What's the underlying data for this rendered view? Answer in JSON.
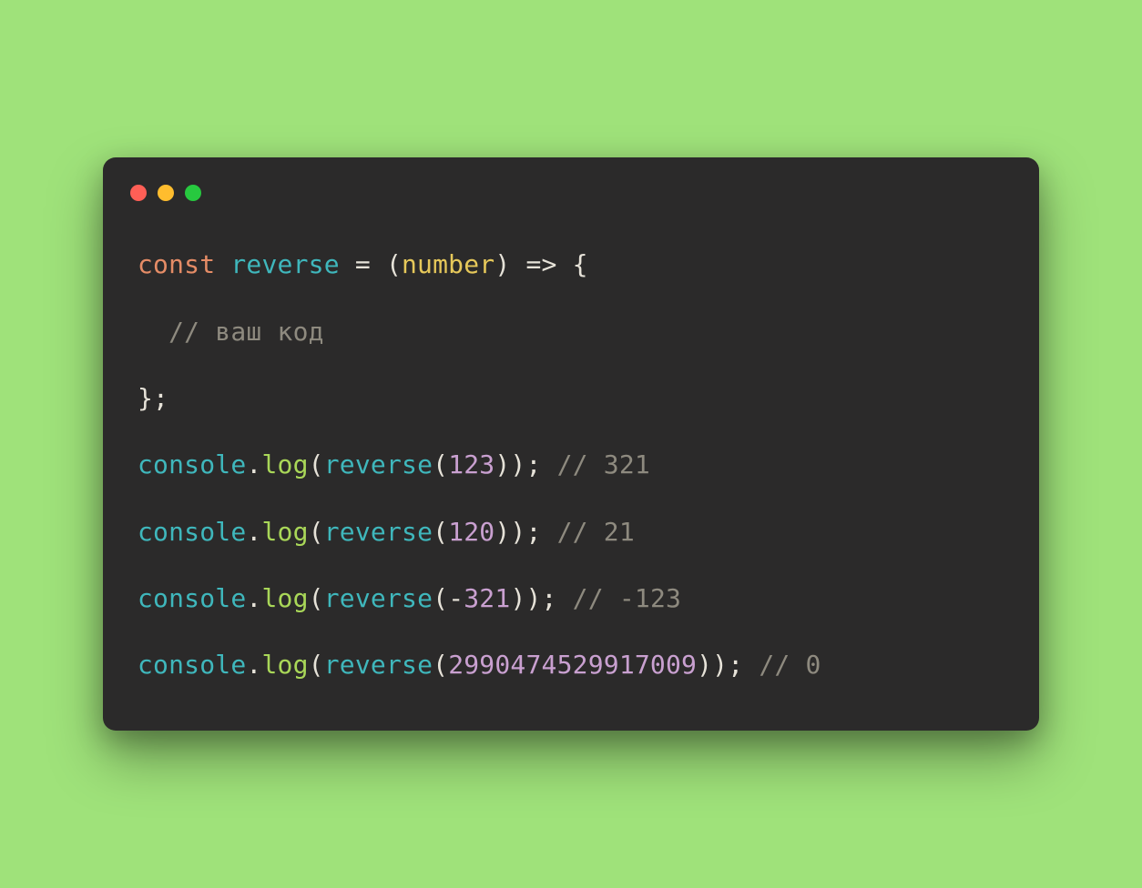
{
  "traffic_lights": {
    "red": "#ff5f56",
    "yellow": "#ffbd2e",
    "green": "#27c93f"
  },
  "code": {
    "line1": {
      "kw": "const",
      "name": "reverse",
      "eq": " = (",
      "param": "number",
      "arrow": ") => {"
    },
    "line2": {
      "indent": "  ",
      "comment": "// ваш код"
    },
    "line3": {
      "close": "};"
    },
    "blank": "",
    "line5": {
      "obj": "console",
      "dot": ".",
      "method": "log",
      "open": "(",
      "fn": "reverse",
      "open2": "(",
      "arg": "123",
      "close": ")); ",
      "comment": "// 321"
    },
    "line6": {
      "obj": "console",
      "dot": ".",
      "method": "log",
      "open": "(",
      "fn": "reverse",
      "open2": "(",
      "arg": "120",
      "close": ")); ",
      "comment": "// 21"
    },
    "line7": {
      "obj": "console",
      "dot": ".",
      "method": "log",
      "open": "(",
      "fn": "reverse",
      "open2": "(",
      "minus": "-",
      "arg": "321",
      "close": ")); ",
      "comment": "// -123"
    },
    "line8": {
      "obj": "console",
      "dot": ".",
      "method": "log",
      "open": "(",
      "fn": "reverse",
      "open2": "(",
      "arg": "2990474529917009",
      "close": ")); ",
      "comment": "// 0"
    }
  }
}
